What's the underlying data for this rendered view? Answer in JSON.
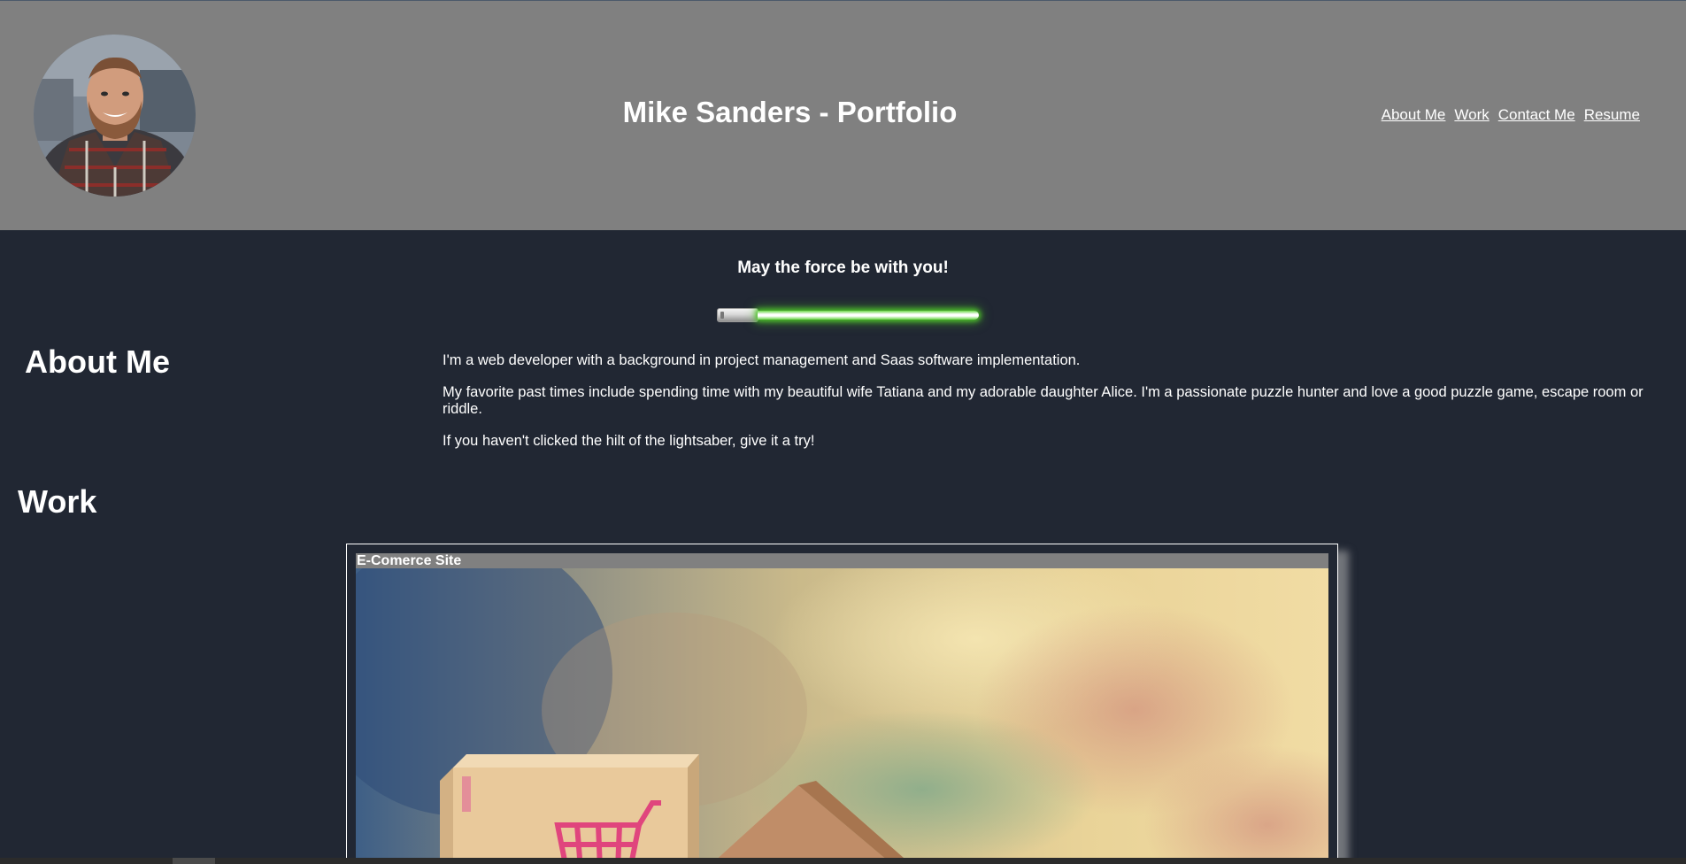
{
  "header": {
    "title": "Mike Sanders - Portfolio",
    "nav": [
      {
        "label": "About Me"
      },
      {
        "label": "Work"
      },
      {
        "label": "Contact Me"
      },
      {
        "label": "Resume"
      }
    ]
  },
  "hero": {
    "tagline": "May the force be with you!"
  },
  "about": {
    "heading": "About Me",
    "paragraphs": [
      "I'm a web developer with a background in project management and Saas software implementation.",
      "My favorite past times include spending time with my beautiful wife Tatiana and my adorable daughter Alice. I'm a passionate puzzle hunter and love a good puzzle game, escape room or riddle.",
      "If you haven't clicked the hilt of the lightsaber, give it a try!"
    ]
  },
  "work": {
    "heading": "Work",
    "projects": [
      {
        "title": "E-Comerce Site"
      }
    ]
  },
  "colors": {
    "header_bg": "#808080",
    "page_bg": "#212733",
    "text": "#ffffff",
    "blade_glow": "#4ec22a"
  }
}
